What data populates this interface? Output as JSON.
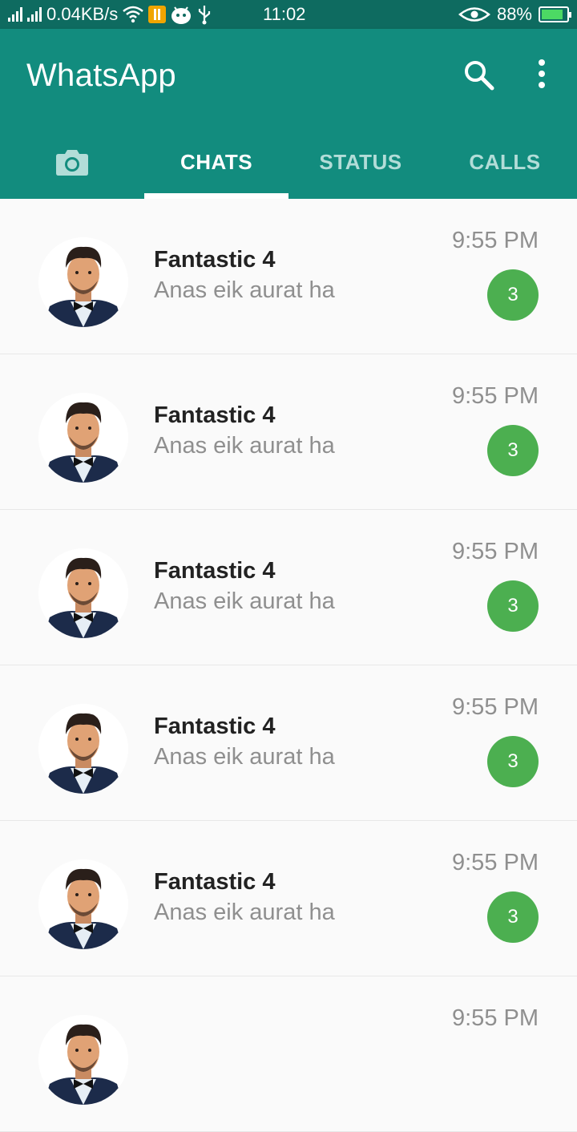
{
  "status_bar": {
    "network_speed": "0.04KB/s",
    "time": "11:02",
    "battery": "88%",
    "battery_level": 0.88,
    "icons": [
      "signal-icon",
      "signal-icon",
      "wifi-icon",
      "notification-icon",
      "android-icon",
      "usb-icon",
      "eye-icon",
      "battery-icon"
    ]
  },
  "app_bar": {
    "title": "WhatsApp",
    "color": "#128c7e",
    "actions": [
      "search-icon",
      "more-vert-icon"
    ]
  },
  "tabs": [
    {
      "label": "",
      "icon": "camera-icon"
    },
    {
      "label": "CHATS",
      "active": true
    },
    {
      "label": "STATUS"
    },
    {
      "label": "CALLS"
    }
  ],
  "chats": [
    {
      "name": "Fantastic 4",
      "preview": "Anas eik aurat ha",
      "time": "9:55 PM",
      "unread": "3"
    },
    {
      "name": "Fantastic 4",
      "preview": "Anas eik aurat ha",
      "time": "9:55 PM",
      "unread": "3"
    },
    {
      "name": "Fantastic 4",
      "preview": "Anas eik aurat ha",
      "time": "9:55 PM",
      "unread": "3"
    },
    {
      "name": "Fantastic 4",
      "preview": "Anas eik aurat ha",
      "time": "9:55 PM",
      "unread": "3"
    },
    {
      "name": "Fantastic 4",
      "preview": "Anas eik aurat ha",
      "time": "9:55 PM",
      "unread": "3"
    },
    {
      "name": "",
      "preview": "",
      "time": "9:55 PM",
      "unread": ""
    }
  ],
  "colors": {
    "accent_green": "#4caf50",
    "header_teal": "#128c7e",
    "status_teal": "#0e6b60"
  }
}
